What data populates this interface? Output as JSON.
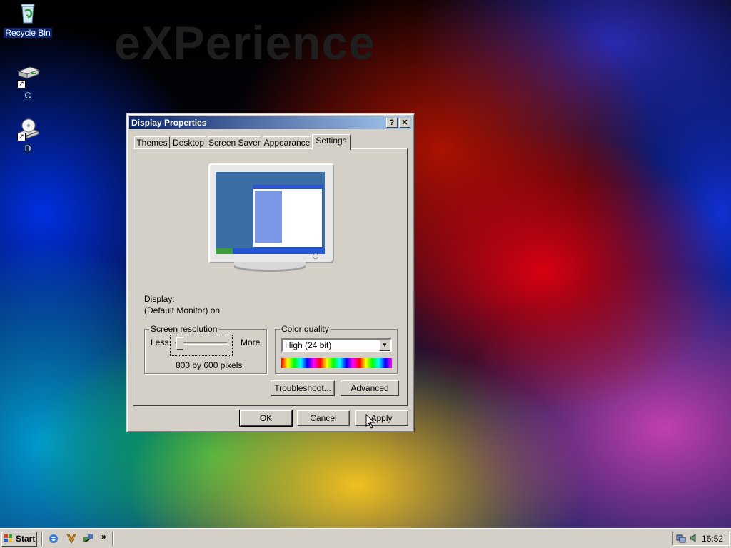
{
  "desktop": {
    "brand_text": "eXPerience",
    "icons": [
      {
        "label": "Recycle Bin",
        "icon": "recycle-bin-icon"
      },
      {
        "label": "C",
        "icon": "hard-drive-icon"
      },
      {
        "label": "D",
        "icon": "cd-drive-icon"
      }
    ]
  },
  "dialog": {
    "title": "Display Properties",
    "help_btn": "?",
    "close_btn": "✕",
    "tabs": [
      "Themes",
      "Desktop",
      "Screen Saver",
      "Appearance",
      "Settings"
    ],
    "active_tab": "Settings",
    "display_label": "Display:",
    "display_value": "(Default Monitor) on",
    "resolution": {
      "legend": "Screen resolution",
      "less": "Less",
      "more": "More",
      "value_text": "800 by 600 pixels",
      "slider_position": 0.1
    },
    "color_quality": {
      "legend": "Color quality",
      "selected": "High (24 bit)"
    },
    "buttons": {
      "troubleshoot": "Troubleshoot...",
      "advanced": "Advanced",
      "ok": "OK",
      "cancel": "Cancel",
      "apply": "Apply"
    }
  },
  "taskbar": {
    "start_label": "Start",
    "overflow": "»",
    "clock": "16:52"
  }
}
